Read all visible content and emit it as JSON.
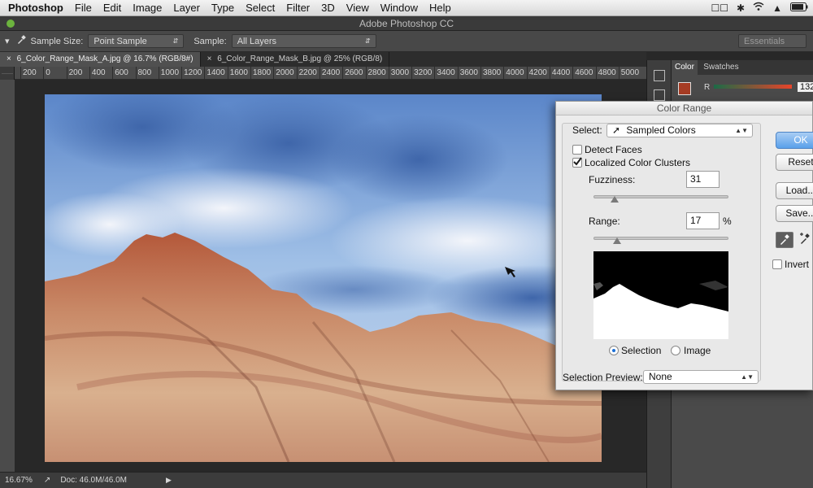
{
  "menubar": {
    "app": "Photoshop",
    "items": [
      "File",
      "Edit",
      "Image",
      "Layer",
      "Type",
      "Select",
      "Filter",
      "3D",
      "View",
      "Window",
      "Help"
    ]
  },
  "window": {
    "title": "Adobe Photoshop CC"
  },
  "options": {
    "sample_size_label": "Sample Size:",
    "sample_size_value": "Point Sample",
    "sample_label": "Sample:",
    "sample_value": "All Layers",
    "workspace": "Essentials"
  },
  "tabs": [
    {
      "label": "6_Color_Range_Mask_A.jpg @ 16.7% (RGB/8#)"
    },
    {
      "label": "6_Color_Range_Mask_B.jpg @ 25% (RGB/8)"
    }
  ],
  "ruler": {
    "labels": [
      "200",
      "0",
      "200",
      "400",
      "600",
      "800",
      "1000",
      "1200",
      "1400",
      "1600",
      "1800",
      "2000",
      "2200",
      "2400",
      "2600",
      "2800",
      "3000",
      "3200",
      "3400",
      "3600",
      "3800",
      "4000",
      "4200",
      "4400",
      "4600",
      "4800",
      "5000"
    ]
  },
  "status": {
    "zoom": "16.67%",
    "doc": "Doc: 46.0M/46.0M"
  },
  "color_panel": {
    "tabs": [
      "Color",
      "Swatches"
    ],
    "channel_label": "R",
    "channel_value": "132",
    "swatch_color": "#a63c24"
  },
  "dialog": {
    "title": "Color Range",
    "select_label": "Select:",
    "select_value": "Sampled Colors",
    "detect_faces": {
      "label": "Detect Faces",
      "checked": false
    },
    "localized": {
      "label": "Localized Color Clusters",
      "checked": true
    },
    "fuzziness_label": "Fuzziness:",
    "fuzziness_value": "31",
    "range_label": "Range:",
    "range_value": "17",
    "range_unit": "%",
    "view_selection": "Selection",
    "view_image": "Image",
    "view_selected": "Selection",
    "preview_label": "Selection Preview:",
    "preview_value": "None",
    "buttons": {
      "ok": "OK",
      "reset": "Reset",
      "load": "Load...",
      "save": "Save..."
    },
    "invert": {
      "label": "Invert",
      "checked": false
    }
  }
}
